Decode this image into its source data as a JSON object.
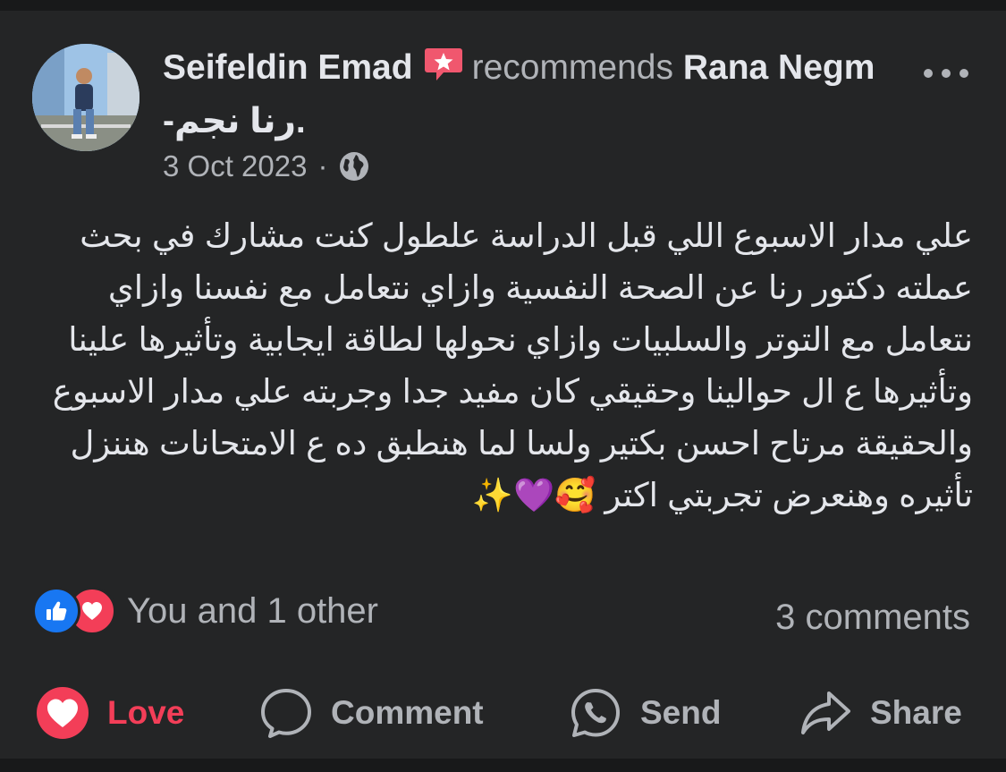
{
  "post": {
    "author": "Seifeldin Emad",
    "verb": "recommends",
    "page": "Rana Negm -رنا نجم.",
    "date": "3 Oct 2023",
    "separator": "·",
    "privacy_icon": "globe-icon",
    "body": "علي مدار الاسبوع اللي قبل الدراسة علطول كنت مشارك في بحث عملته دكتور رنا عن الصحة النفسية وازاي نتعامل مع نفسنا وازاي نتعامل مع التوتر والسلبيات وازاي نحولها لطاقة ايجابية وتأثيرها علينا وتأثيرها ع ال حوالينا وحقيقي كان مفيد جدا وجربته علي مدار الاسبوع والحقيقة مرتاح احسن بكتير ولسا لما هنطبق ده ع الامتحانات هننزل تأثيره وهنعرض تجربتي اكتر 🥰💜✨"
  },
  "engagement": {
    "reactions_label": "You and 1 other",
    "comments_label": "3 comments",
    "reaction_icons": [
      "like-icon",
      "love-icon"
    ]
  },
  "actions": {
    "love_label": "Love",
    "comment_label": "Comment",
    "send_label": "Send",
    "share_label": "Share"
  },
  "colors": {
    "background": "#18191a",
    "card": "#242526",
    "text_primary": "#e4e6eb",
    "text_secondary": "#b0b3b8",
    "love": "#f33e58",
    "like": "#1877f2"
  }
}
